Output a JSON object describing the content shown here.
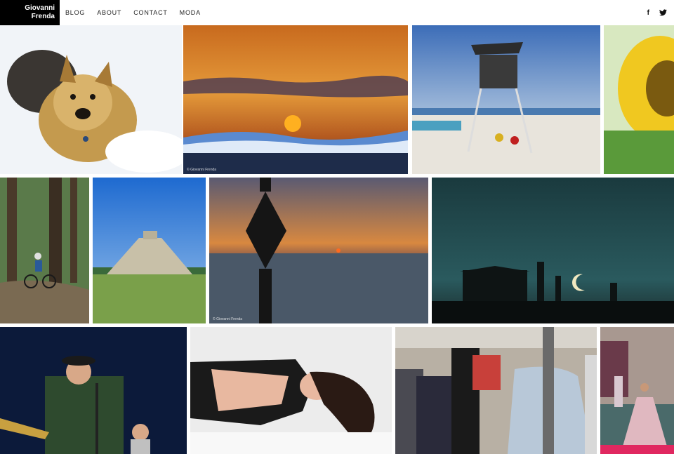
{
  "site": {
    "logo_line1": "Giovanni",
    "logo_line2": "Frenda"
  },
  "nav": {
    "items": [
      "BLOG",
      "ABOUT",
      "CONTACT",
      "MODA"
    ]
  },
  "social": {
    "facebook_icon": "f",
    "twitter_icon": "twitter-bird"
  },
  "gallery": {
    "credit": "© Giovanni Frenda",
    "photos": [
      {
        "subject": "dog-in-snow"
      },
      {
        "subject": "sunset-over-wave"
      },
      {
        "subject": "lifeguard-tower"
      },
      {
        "subject": "sunflower"
      },
      {
        "subject": "mountain-biker"
      },
      {
        "subject": "pyramid"
      },
      {
        "subject": "sea-sunset-buoy"
      },
      {
        "subject": "crescent-moon-night"
      },
      {
        "subject": "musician-singer"
      },
      {
        "subject": "model-lying"
      },
      {
        "subject": "clothing-store"
      },
      {
        "subject": "fashion-show"
      }
    ]
  }
}
